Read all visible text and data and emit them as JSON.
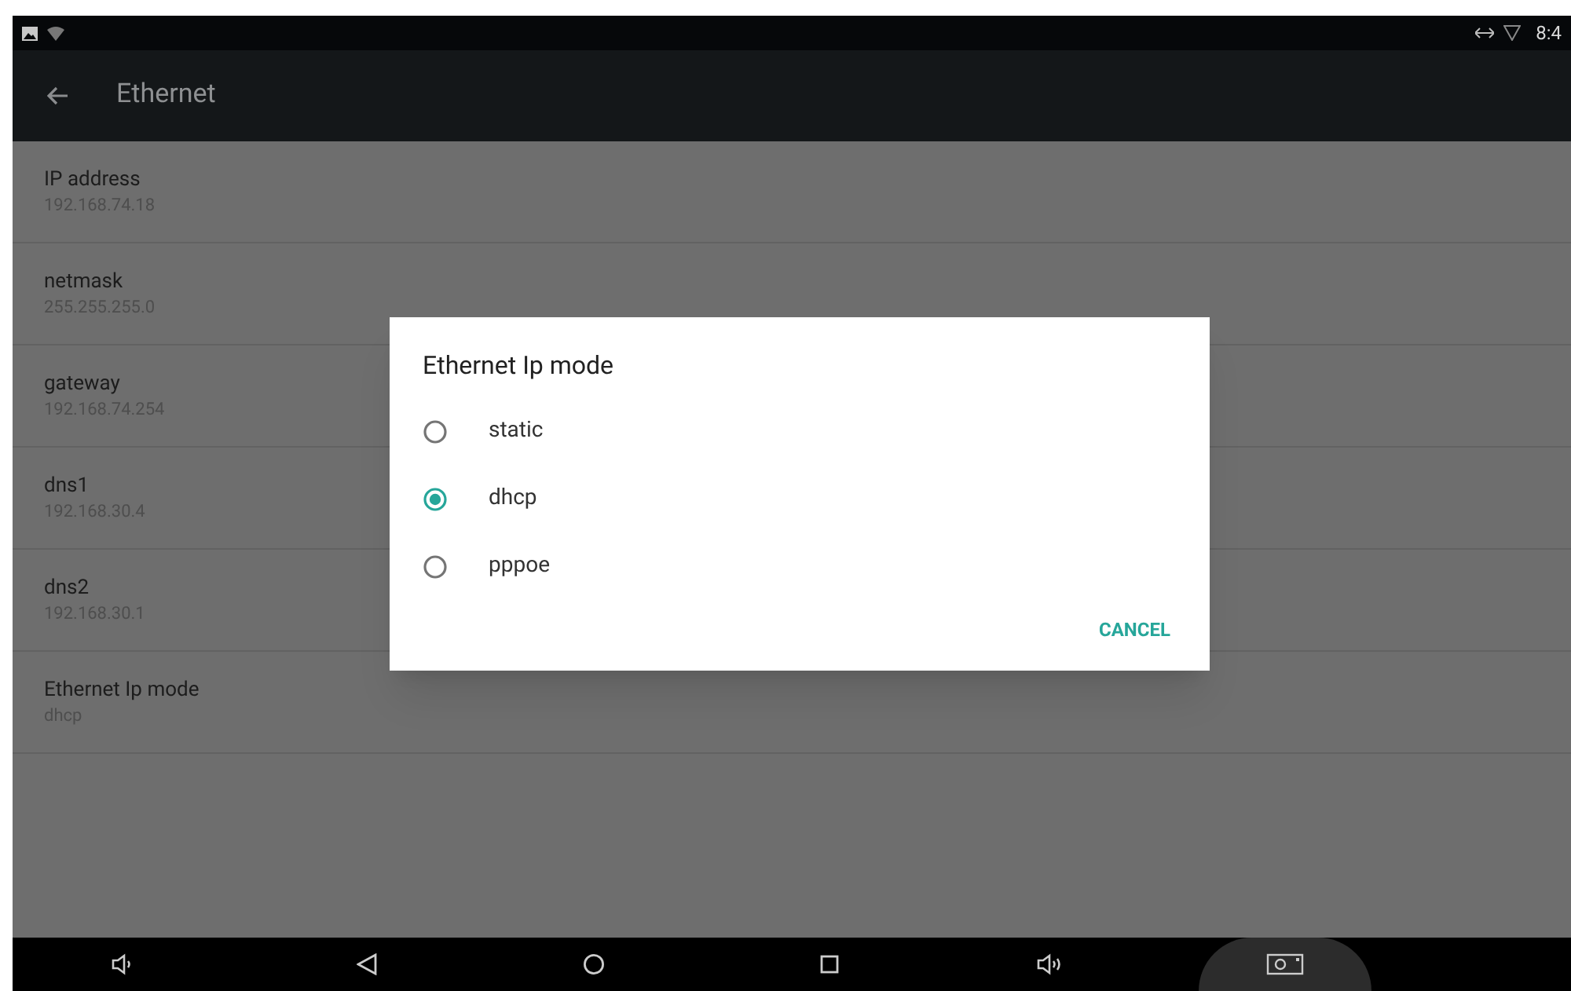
{
  "status_bar": {
    "time": "8:4"
  },
  "toolbar": {
    "title": "Ethernet"
  },
  "settings": [
    {
      "label": "IP address",
      "value": "192.168.74.18"
    },
    {
      "label": "netmask",
      "value": "255.255.255.0"
    },
    {
      "label": "gateway",
      "value": "192.168.74.254"
    },
    {
      "label": "dns1",
      "value": "192.168.30.4"
    },
    {
      "label": "dns2",
      "value": "192.168.30.1"
    },
    {
      "label": "Ethernet Ip mode",
      "value": "dhcp"
    }
  ],
  "dialog": {
    "title": "Ethernet Ip mode",
    "options": [
      {
        "label": "static",
        "selected": false
      },
      {
        "label": "dhcp",
        "selected": true
      },
      {
        "label": "pppoe",
        "selected": false
      }
    ],
    "button": "CANCEL"
  }
}
